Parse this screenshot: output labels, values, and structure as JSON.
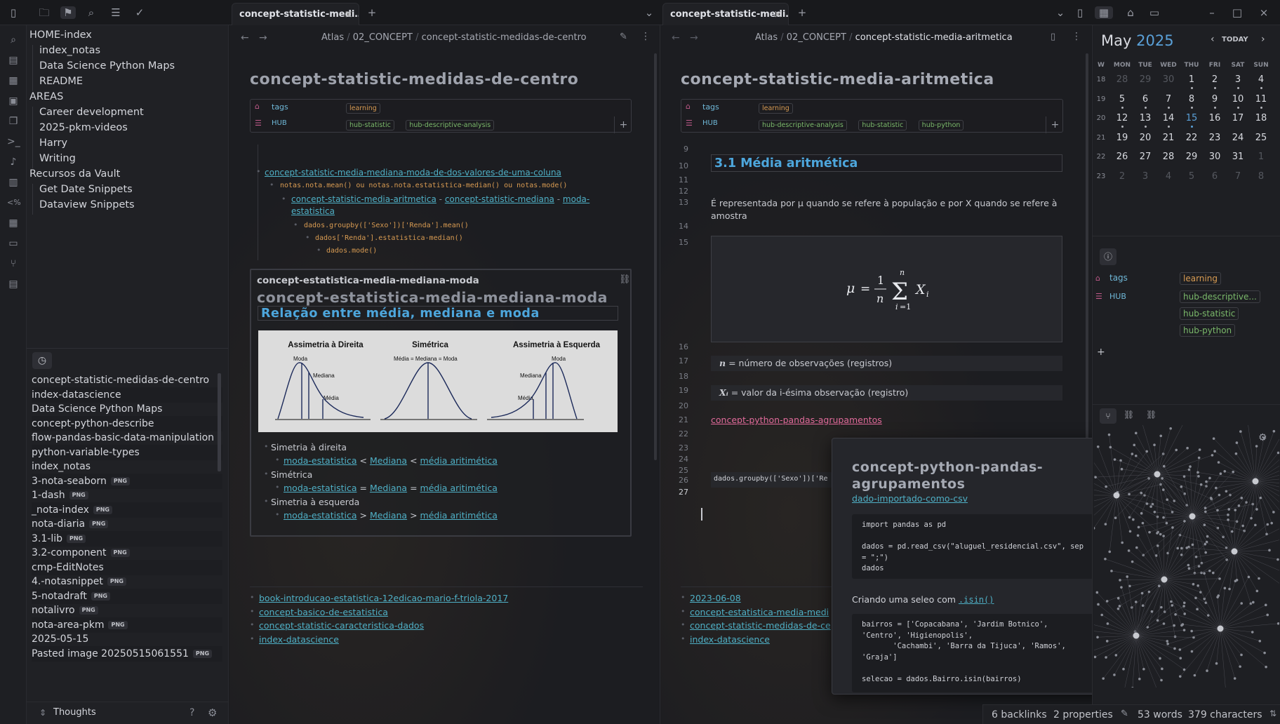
{
  "tabs": {
    "left": {
      "label": "concept-statistic-medi…"
    },
    "right": {
      "label": "concept-statistic-medi…"
    }
  },
  "sidebar": {
    "tree": [
      {
        "label": "HOME-index",
        "level": 0
      },
      {
        "label": "index_notas",
        "level": 1
      },
      {
        "label": "Data Science Python Maps",
        "level": 1
      },
      {
        "label": "README",
        "level": 1
      },
      {
        "label": "AREAS",
        "level": 0
      },
      {
        "label": "Career development",
        "level": 1
      },
      {
        "label": "2025-pkm-videos",
        "level": 1
      },
      {
        "label": "Harry",
        "level": 1
      },
      {
        "label": "Writing",
        "level": 1
      },
      {
        "label": "Recursos da Vault",
        "level": 0
      },
      {
        "label": "Get Date Snippets",
        "level": 1
      },
      {
        "label": "Dataview Snippets",
        "level": 1
      }
    ],
    "recent": [
      {
        "label": "concept-statistic-medidas-de-centro",
        "badge": ""
      },
      {
        "label": "index-datascience",
        "badge": ""
      },
      {
        "label": "Data Science Python Maps",
        "badge": ""
      },
      {
        "label": "concept-python-describe",
        "badge": ""
      },
      {
        "label": "flow-pandas-basic-data-manipulation",
        "badge": ""
      },
      {
        "label": "python-variable-types",
        "badge": ""
      },
      {
        "label": "index_notas",
        "badge": ""
      },
      {
        "label": "3-nota-seaborn",
        "badge": "PNG"
      },
      {
        "label": "1-dash",
        "badge": "PNG"
      },
      {
        "label": "_nota-index",
        "badge": "PNG"
      },
      {
        "label": "nota-diaria",
        "badge": "PNG"
      },
      {
        "label": "3.1-lib",
        "badge": "PNG"
      },
      {
        "label": "3.2-component",
        "badge": "PNG"
      },
      {
        "label": "cmp-EditNotes",
        "badge": ""
      },
      {
        "label": "4.-notasnippet",
        "badge": "PNG"
      },
      {
        "label": "5-notadraft",
        "badge": "PNG"
      },
      {
        "label": "notalivro",
        "badge": "PNG"
      },
      {
        "label": "nota-area-pkm",
        "badge": "PNG"
      },
      {
        "label": "2025-05-15",
        "badge": ""
      },
      {
        "label": "Pasted image 20250515061551",
        "badge": "PNG"
      }
    ],
    "footer_label": "Thoughts"
  },
  "left_pane": {
    "breadcrumb": [
      "Atlas",
      "02_CONCEPT",
      "concept-statistic-medidas-de-centro"
    ],
    "title": "concept-statistic-medidas-de-centro",
    "props": {
      "tags_key": "tags",
      "tags": [
        "learning"
      ],
      "hub_key": "HUB",
      "hub": [
        "hub-statistic",
        "hub-descriptive-analysis"
      ]
    },
    "outline": {
      "l1": "concept-statistic-media-mediana-moda-de-dos-valores-de-uma-coluna",
      "l2": "notas.nota.mean() ou notas.nota.estatistica-median() ou notas.mode()",
      "l3a": "concept-statistic-media-aritmetica",
      "l3b": "concept-statistic-mediana",
      "l3c": "moda-",
      "l3d": "estatistica",
      "l4": "dados.groupby(['Sexo'])['Renda'].mean()",
      "l5": "dados['Renda'].estatistica-median()",
      "l6": "dados.mode()"
    },
    "embed": {
      "small_title": "concept-estatistica-media-mediana-moda",
      "big_title": "concept-estatistica-media-mediana-moda",
      "heading": "Relação entre média, mediana e moda",
      "figure": {
        "panels": [
          {
            "title": "Assimetria à Direita",
            "labels": [
              "Moda",
              "Mediana",
              "Média"
            ]
          },
          {
            "title": "Simétrica",
            "labels": [
              "Média = Mediana = Moda"
            ]
          },
          {
            "title": "Assimetria à Esquerda",
            "labels": [
              "Moda",
              "Mediana",
              "Média"
            ]
          }
        ]
      },
      "list": [
        {
          "label": "Simetria à direita",
          "links": [
            "moda-estatistica",
            "Mediana",
            "média aritimética"
          ],
          "op": "<"
        },
        {
          "label": "Simétrica",
          "links": [
            "moda-estatistica",
            "Mediana",
            "média aritimética"
          ],
          "op": "="
        },
        {
          "label": "Simetria à esquerda",
          "links": [
            "moda-estatistica",
            "Mediana",
            "média aritimética"
          ],
          "op": ">"
        }
      ]
    },
    "backlinks": [
      "book-introducao-estatistica-12edicao-mario-f-triola-2017",
      "concept-basico-de-estatistica",
      "concept-statistic-caracteristica-dados",
      "index-datascience"
    ]
  },
  "right_pane": {
    "breadcrumb": [
      "Atlas",
      "02_CONCEPT",
      "concept-statistic-media-aritmetica"
    ],
    "title": "concept-statistic-media-aritmetica",
    "props": {
      "tags_key": "tags",
      "tags": [
        "learning"
      ],
      "hub_key": "HUB",
      "hub": [
        "hub-descriptive-analysis",
        "hub-statistic",
        "hub-python"
      ]
    },
    "heading": "3.1 Média aritmética",
    "line13": "É representada por μ quando se refere à população e por X quando se refere à",
    "line13b": "amostra",
    "formula": "μ = (1/n) Σ Xᵢ",
    "def_n": "= número de observações (registros)",
    "def_x": "= valor da i-ésima observação (registro)",
    "link21": "concept-python-pandas-agrupamentos",
    "code24": "dados.groupby(['Sexo'])['Re",
    "line_numbers": [
      "9",
      "10",
      "11",
      "12",
      "13",
      "14",
      "15",
      "16",
      "17",
      "18",
      "19",
      "20",
      "21",
      "22",
      "23",
      "24",
      "25",
      "26",
      "27"
    ],
    "backlinks": [
      "2023-06-08",
      "concept-estatistica-media-medi",
      "concept-statistic-medidas-de-ce",
      "index-datascience"
    ]
  },
  "hover_card": {
    "title_l1": "concept-python-pandas-",
    "title_l2": "agrupamentos",
    "link": "dado-importado-como-csv",
    "code1": "import pandas as pd\n\ndados = pd.read_csv(\"aluguel_residencial.csv\", sep\n= \";\")\ndados",
    "text": "Criando uma seleo com",
    "text_link": ".isin()",
    "code2": "bairros = ['Copacabana', 'Jardim Botnico',\n'Centro', 'Higienopolis',\n       'Cachambi', 'Barra da Tijuca', 'Ramos',\n'Graja']\n\nselecao = dados.Bairro.isin(bairros)"
  },
  "calendar": {
    "month": "May",
    "year": "2025",
    "today_label": "TODAY",
    "weekdays": [
      "W",
      "MON",
      "TUE",
      "WED",
      "THU",
      "FRI",
      "SAT",
      "SUN"
    ],
    "weeks": [
      {
        "wk": "18",
        "days": [
          "28",
          "29",
          "30",
          "1",
          "2",
          "3",
          "4"
        ],
        "dim": [
          true,
          true,
          true,
          false,
          false,
          false,
          false
        ]
      },
      {
        "wk": "19",
        "days": [
          "5",
          "6",
          "7",
          "8",
          "9",
          "10",
          "11"
        ],
        "dim": [
          false,
          false,
          false,
          false,
          false,
          false,
          false
        ]
      },
      {
        "wk": "20",
        "days": [
          "12",
          "13",
          "14",
          "15",
          "16",
          "17",
          "18"
        ],
        "dim": [
          false,
          false,
          false,
          false,
          false,
          false,
          false
        ]
      },
      {
        "wk": "21",
        "days": [
          "19",
          "20",
          "21",
          "22",
          "23",
          "24",
          "25"
        ],
        "dim": [
          false,
          false,
          false,
          false,
          false,
          false,
          false
        ]
      },
      {
        "wk": "22",
        "days": [
          "26",
          "27",
          "28",
          "29",
          "30",
          "31",
          "1"
        ],
        "dim": [
          false,
          false,
          false,
          false,
          false,
          false,
          true
        ]
      },
      {
        "wk": "23",
        "days": [
          "2",
          "3",
          "4",
          "5",
          "6",
          "7",
          "8"
        ],
        "dim": [
          true,
          true,
          true,
          true,
          true,
          true,
          true
        ]
      }
    ]
  },
  "properties_panel": {
    "tags_key": "tags",
    "tags": [
      "learning"
    ],
    "hub_key": "HUB",
    "hub": [
      "hub-descriptive...",
      "hub-statistic",
      "hub-python"
    ]
  },
  "status_bar": {
    "backlinks": "6 backlinks",
    "properties": "2 properties",
    "words": "53 words",
    "chars": "379 characters"
  },
  "colors": {
    "accent": "#4fb0c6",
    "tag_orange": "#d89b52",
    "tag_green": "#7ab86a",
    "calendar_accent": "#5aa0d8"
  }
}
